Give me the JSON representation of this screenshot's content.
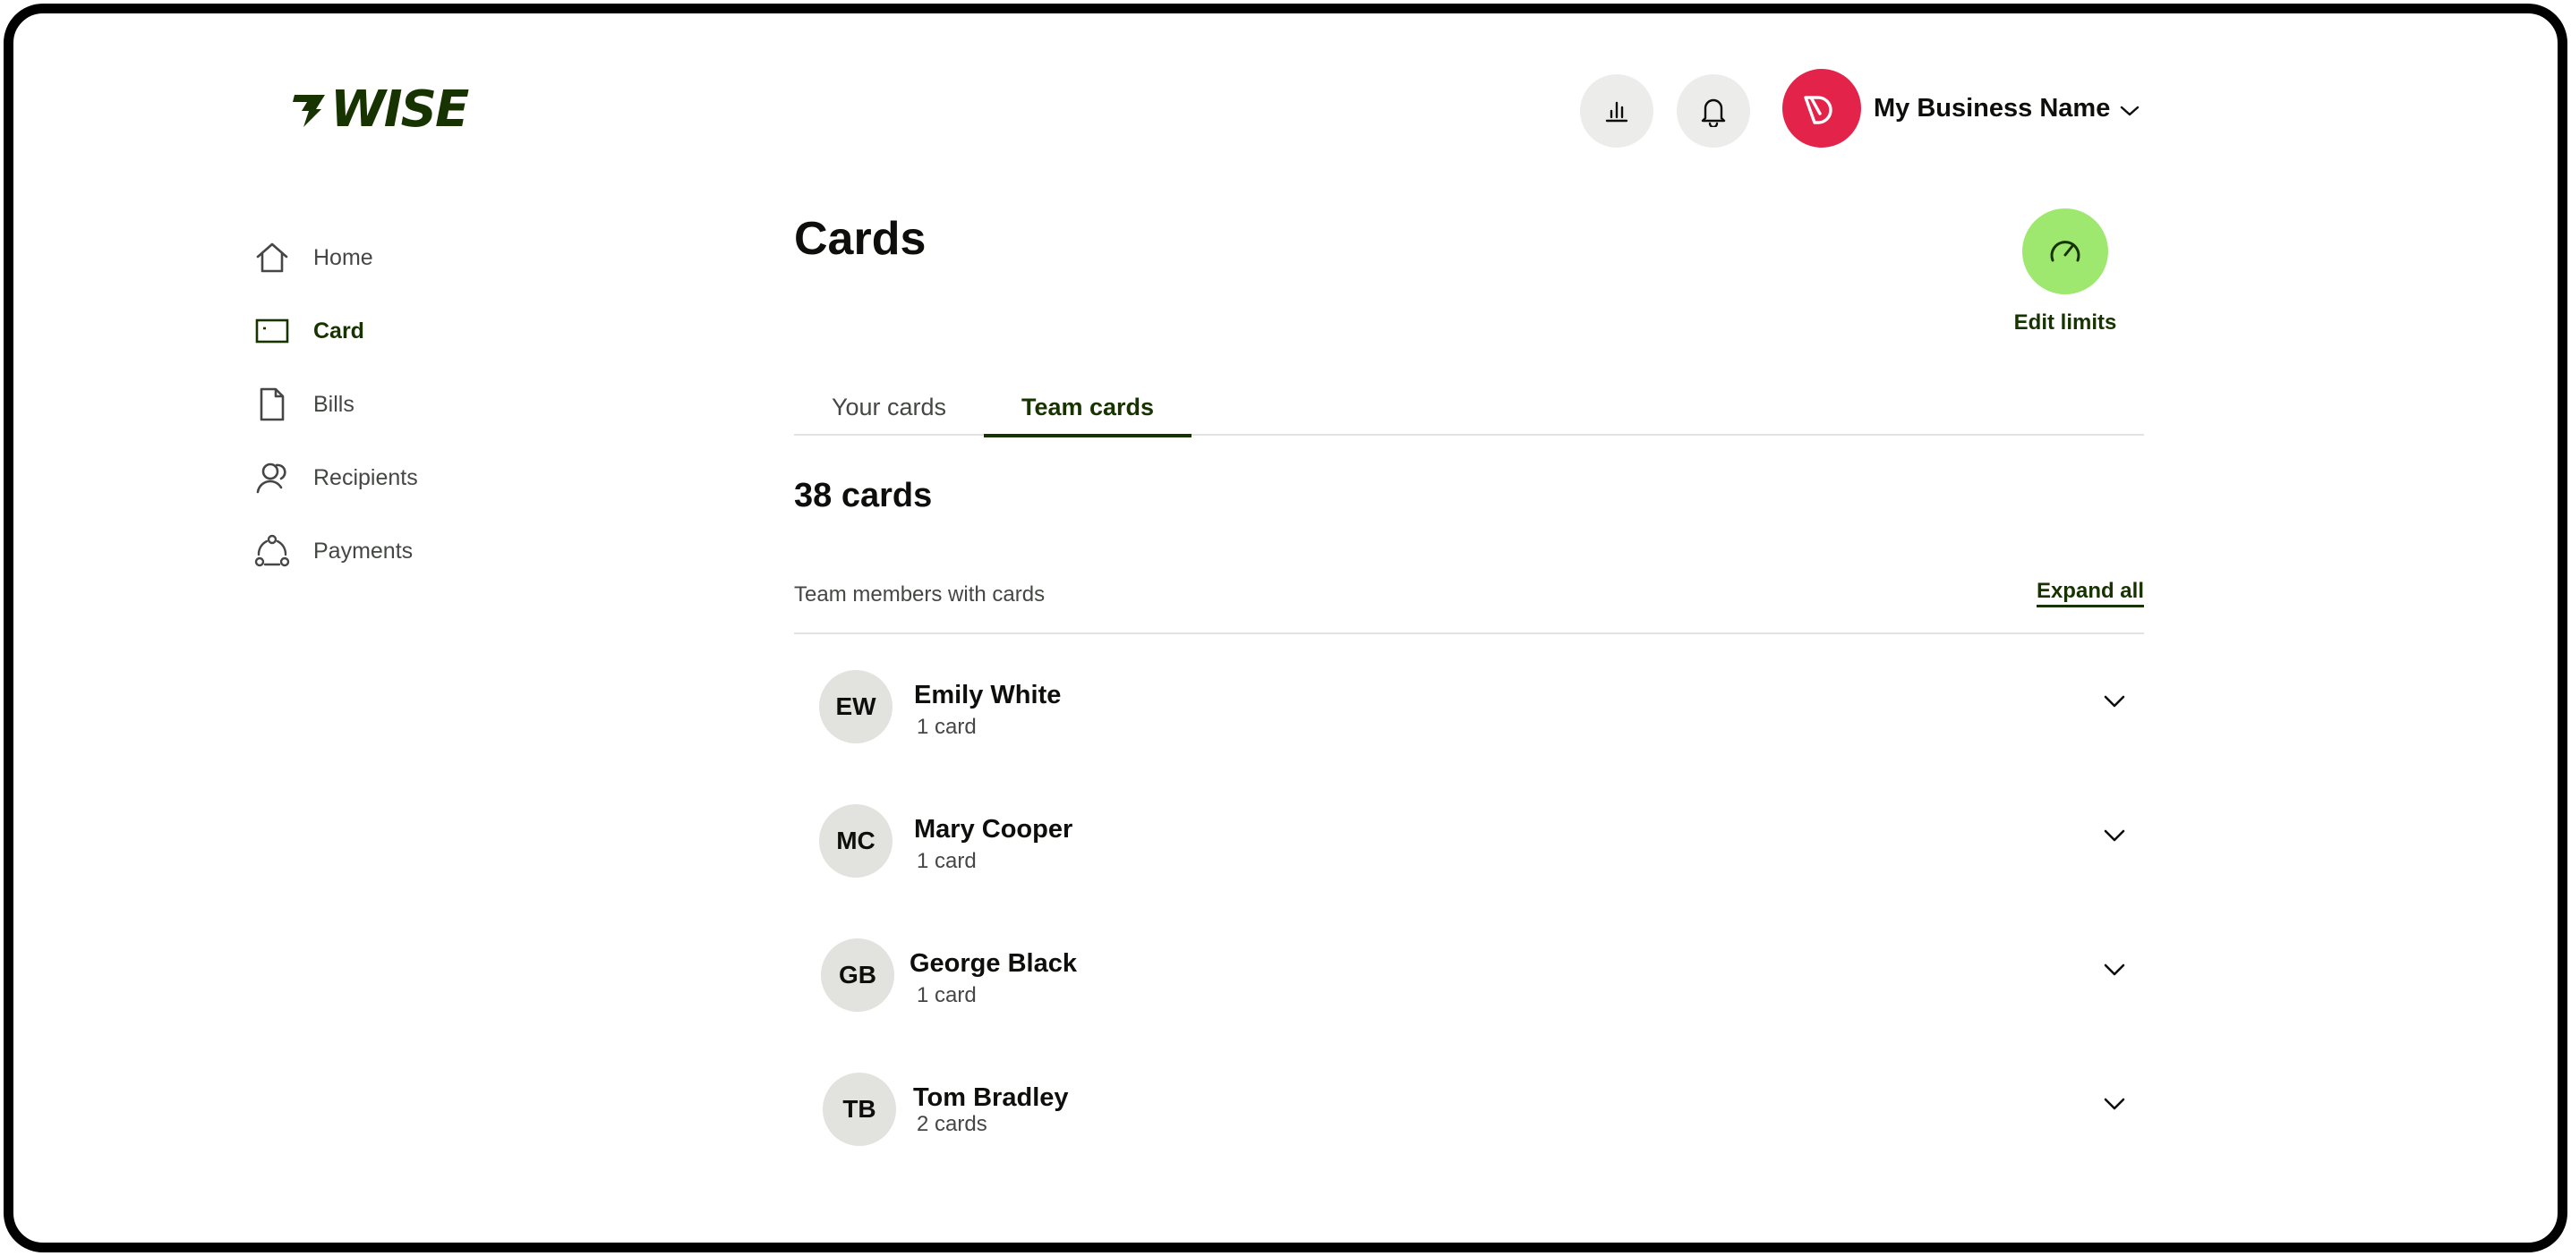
{
  "brand": {
    "name": "WISE",
    "color": "#163300",
    "accent": "#9fe870"
  },
  "header": {
    "insights_icon": "bar-chart-icon",
    "notifications_icon": "bell-icon",
    "account": {
      "name": "My Business Name",
      "avatar_color": "#e3234a"
    }
  },
  "sidebar": {
    "items": [
      {
        "label": "Home",
        "icon": "home-icon",
        "active": false
      },
      {
        "label": "Card",
        "icon": "card-icon",
        "active": true
      },
      {
        "label": "Bills",
        "icon": "document-icon",
        "active": false
      },
      {
        "label": "Recipients",
        "icon": "people-icon",
        "active": false
      },
      {
        "label": "Payments",
        "icon": "payments-icon",
        "active": false
      }
    ]
  },
  "main": {
    "title": "Cards",
    "edit_limits": {
      "label": "Edit limits",
      "icon": "speedometer-icon"
    },
    "tabs": [
      {
        "label": "Your cards",
        "active": false
      },
      {
        "label": "Team cards",
        "active": true
      }
    ],
    "count_label": "38 cards",
    "section": {
      "title": "Team members with cards",
      "expand_label": "Expand all"
    },
    "members": [
      {
        "initials": "EW",
        "name": "Emily White",
        "cards": "1 card"
      },
      {
        "initials": "MC",
        "name": "Mary Cooper",
        "cards": "1 card"
      },
      {
        "initials": "GB",
        "name": "George Black",
        "cards": "1 card"
      },
      {
        "initials": "TB",
        "name": "Tom Bradley",
        "cards": "2 cards"
      }
    ]
  }
}
